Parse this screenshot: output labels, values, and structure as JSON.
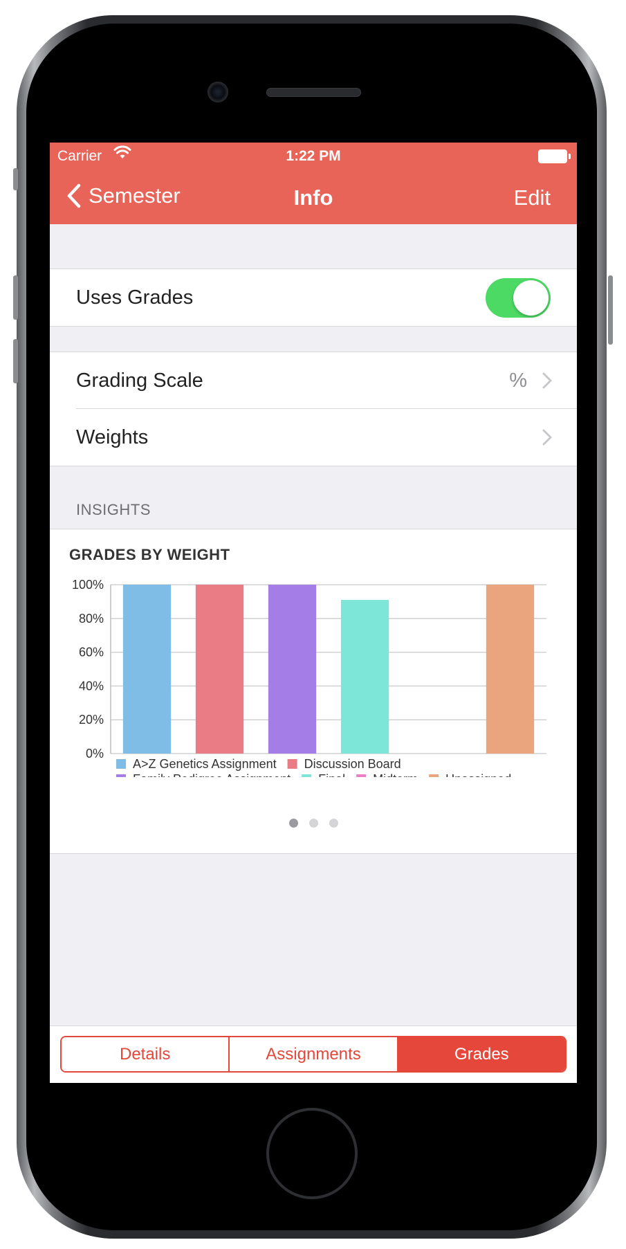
{
  "status_bar": {
    "carrier": "Carrier",
    "time": "1:22 PM"
  },
  "nav": {
    "back_label": "Semester",
    "title": "Info",
    "edit_label": "Edit"
  },
  "settings": {
    "uses_grades": {
      "label": "Uses Grades",
      "on": true
    },
    "grading_scale": {
      "label": "Grading Scale",
      "value": "%"
    },
    "weights": {
      "label": "Weights"
    }
  },
  "insights": {
    "header": "INSIGHTS",
    "page_count": 3,
    "active_page": 0
  },
  "chart_data": {
    "type": "bar",
    "title": "GRADES BY WEIGHT",
    "ylim": [
      0,
      100
    ],
    "y_ticks": [
      "0%",
      "20%",
      "40%",
      "60%",
      "80%",
      "100%"
    ],
    "grid": true,
    "legend_position": "bottom",
    "series": [
      {
        "name": "A>Z Genetics Assignment",
        "value": 100,
        "color": "#7fbde7"
      },
      {
        "name": "Discussion Board",
        "value": 100,
        "color": "#e97c85"
      },
      {
        "name": "Family Pedigree Assignment",
        "value": 100,
        "color": "#a57de6"
      },
      {
        "name": "Final",
        "value": 91,
        "color": "#7ee6d8"
      },
      {
        "name": "Midterm",
        "value": 0,
        "color": "#ea80c8"
      },
      {
        "name": "Unassigned",
        "value": 100,
        "color": "#eaa47e"
      }
    ]
  },
  "tabs": [
    {
      "label": "Details",
      "selected": false
    },
    {
      "label": "Assignments",
      "selected": false
    },
    {
      "label": "Grades",
      "selected": true
    }
  ],
  "colors": {
    "accent": "#e96458",
    "tab_accent": "#e5473b",
    "toggle_on": "#4cd964"
  }
}
